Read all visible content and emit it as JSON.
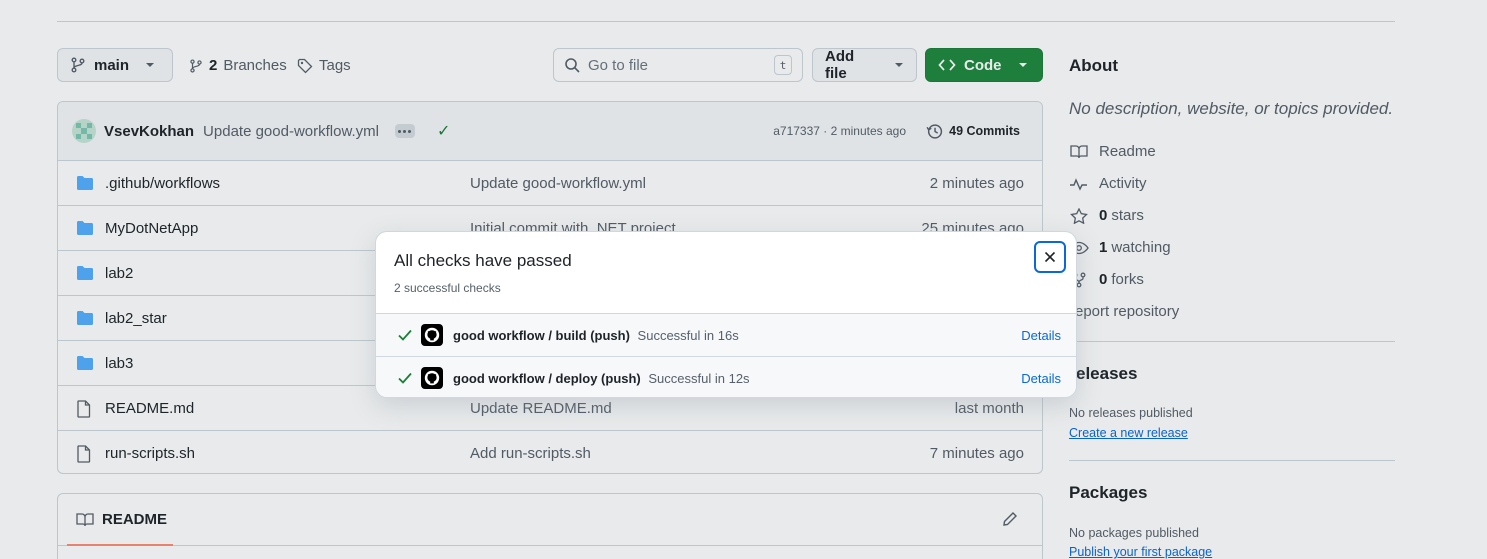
{
  "toolbar": {
    "branch_label": "main",
    "branches_count": "2",
    "branches_label": "Branches",
    "tags_label": "Tags",
    "search_placeholder": "Go to file",
    "search_shortcut": "t",
    "add_file_label": "Add file",
    "code_label": "Code"
  },
  "commit": {
    "author": "VsevKokhan",
    "message": "Update good-workflow.yml",
    "meta": "a717337 · 2 minutes ago",
    "commits_label": "49 Commits"
  },
  "files": [
    {
      "type": "folder",
      "name": ".github/workflows",
      "message": "Update good-workflow.yml",
      "age": "2 minutes ago"
    },
    {
      "type": "folder",
      "name": "MyDotNetApp",
      "message": "Initial commit with .NET project",
      "age": "25 minutes ago"
    },
    {
      "type": "folder",
      "name": "lab2",
      "message": "",
      "age": ""
    },
    {
      "type": "folder",
      "name": "lab2_star",
      "message": "",
      "age": ""
    },
    {
      "type": "folder",
      "name": "lab3",
      "message": "",
      "age": ""
    },
    {
      "type": "file",
      "name": "README.md",
      "message": "Update README.md",
      "age": "last month"
    },
    {
      "type": "file",
      "name": "run-scripts.sh",
      "message": "Add run-scripts.sh",
      "age": "7 minutes ago"
    }
  ],
  "readme": {
    "tab_label": "README"
  },
  "sidebar": {
    "about_title": "About",
    "description": "No description, website, or topics provided.",
    "readme_label": "Readme",
    "activity_label": "Activity",
    "stars_count": "0",
    "stars_label": "stars",
    "watching_count": "1",
    "watching_label": "watching",
    "forks_count": "0",
    "forks_label": "forks",
    "report_label": "eport repository",
    "releases_title": "eleases",
    "releases_empty": "No releases published",
    "create_release_link": "Create a new release",
    "packages_title": "Packages",
    "packages_empty": "No packages published",
    "publish_package_link": "Publish your first package"
  },
  "dialog": {
    "title": "All checks have passed",
    "subtitle": "2 successful checks",
    "close_label": "Close",
    "checks": [
      {
        "job": "good workflow / build (push)",
        "status": "Successful in 16s",
        "details": "Details"
      },
      {
        "job": "good workflow / deploy (push)",
        "status": "Successful in 12s",
        "details": "Details"
      }
    ]
  },
  "colors": {
    "accent": "#0969da",
    "success": "#1a7f37",
    "code_button": "#1f883d",
    "folder": "#54aeff"
  }
}
